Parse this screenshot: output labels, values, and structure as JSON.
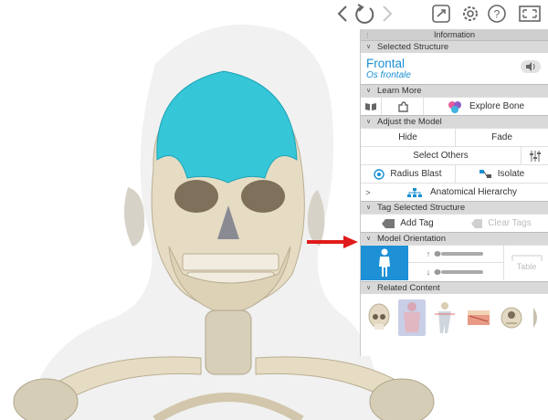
{
  "panel": {
    "title": "Information",
    "sections": {
      "selected_structure": "Selected Structure",
      "learn_more": "Learn More",
      "adjust_model": "Adjust the Model",
      "tag_structure": "Tag Selected Structure",
      "model_orientation": "Model Orientation",
      "related_content": "Related Content"
    },
    "structure": {
      "name": "Frontal",
      "latin": "Os frontale"
    },
    "learn_more": {
      "explore_label": "Explore Bone"
    },
    "adjust": {
      "hide": "Hide",
      "fade": "Fade",
      "select_others": "Select Others",
      "radius_blast": "Radius Blast",
      "isolate": "Isolate",
      "hierarchy": "Anatomical Hierarchy"
    },
    "tag": {
      "add": "Add Tag",
      "clear": "Clear Tags"
    },
    "orientation": {
      "table": "Table"
    }
  },
  "toolbar_icons": [
    "back-arrow-icon",
    "reset-icon",
    "forward-arrow-icon",
    "share-icon",
    "settings-icon",
    "help-icon",
    "fullscreen-icon"
  ],
  "colors": {
    "accent": "#1a8fd1",
    "selected_bone": "#35c6d8",
    "bone": "#e6dcc4",
    "arrow": "#e01b1b",
    "section_bg": "#d9d9d9"
  }
}
